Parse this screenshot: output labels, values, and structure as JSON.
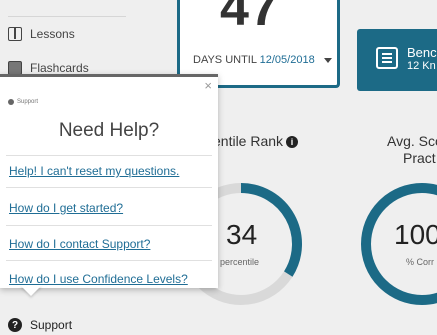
{
  "sidebar": {
    "items": [
      {
        "label": "Lessons",
        "icon": "book-icon"
      },
      {
        "label": "Flashcards",
        "icon": "flashcards-icon"
      },
      {
        "label": "Support",
        "icon": "question-circle-icon"
      }
    ]
  },
  "countdown": {
    "days": "47",
    "label": "DAYS UNTIL",
    "date": "12/05/2018"
  },
  "benchmark": {
    "title": "Benc",
    "subtitle": "12 Kn"
  },
  "stats": {
    "percentile": {
      "title": "entile Rank",
      "value": "34",
      "sub": "percentile",
      "fraction": 0.34
    },
    "avg_score": {
      "title_line1": "Avg. Sco",
      "title_line2": "Pract",
      "value": "100",
      "sub": "% Corr",
      "fraction": 1.0
    }
  },
  "help_popup": {
    "brand": "Support",
    "close": "×",
    "title": "Need Help?",
    "links": [
      "Help! I can't reset my questions.",
      "How do I get started?",
      "How do I contact Support?",
      "How do I use Confidence Levels?"
    ]
  },
  "colors": {
    "accent": "#1c6a86",
    "link": "#1f6d95",
    "ring_track": "#d9d9d9"
  }
}
